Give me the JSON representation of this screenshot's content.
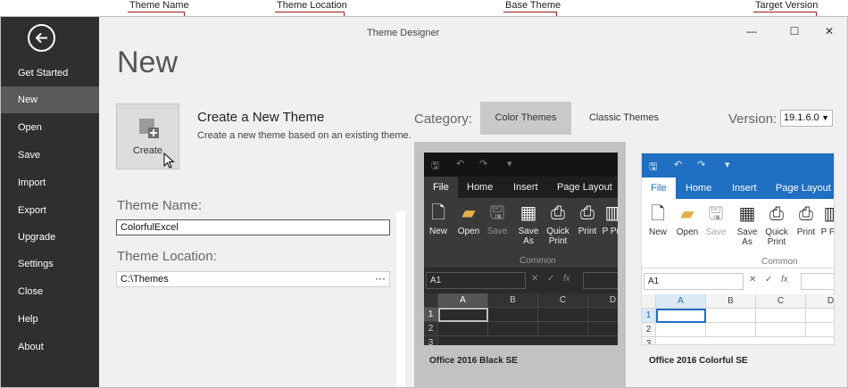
{
  "annotations": [
    {
      "id": "theme-name",
      "label": "Theme Name"
    },
    {
      "id": "theme-location",
      "label": "Theme Location"
    },
    {
      "id": "base-theme",
      "label": "Base Theme"
    },
    {
      "id": "target-version",
      "label": "Target Version"
    }
  ],
  "window": {
    "title": "Theme Designer",
    "minimize_glyph": "—",
    "maximize_glyph": "☐",
    "close_glyph": "✕"
  },
  "sidebar": {
    "back_icon": "back-arrow-icon",
    "items": [
      {
        "label": "Get Started"
      },
      {
        "label": "New",
        "active": true
      },
      {
        "label": "Open"
      },
      {
        "label": "Save"
      },
      {
        "label": "Import"
      },
      {
        "label": "Export"
      },
      {
        "label": "Upgrade"
      },
      {
        "label": "Settings"
      },
      {
        "label": "Close"
      },
      {
        "label": "Help"
      },
      {
        "label": "About"
      }
    ]
  },
  "main": {
    "page_title": "New",
    "create": {
      "tile_label": "Create",
      "heading": "Create a New Theme",
      "description": "Create a new theme based on an existing theme."
    },
    "theme_name": {
      "label": "Theme Name:",
      "value": "ColorfulExcel"
    },
    "theme_location": {
      "label": "Theme Location:",
      "value": "C:\\Themes",
      "browse": "···"
    }
  },
  "themes": {
    "category_label": "Category:",
    "tabs": [
      {
        "label": "Color Themes",
        "selected": true
      },
      {
        "label": "Classic Themes",
        "selected": false
      }
    ],
    "version_label": "Version:",
    "version_value": "19.1.6.0",
    "cards": [
      {
        "name": "Office 2016 Black SE",
        "selected": true
      },
      {
        "name": "Office 2016 Colorful SE",
        "selected": false
      }
    ]
  },
  "preview": {
    "qat": {
      "save": "🖫",
      "undo": "↶",
      "redo": "↷",
      "more": "▾"
    },
    "tabs": {
      "file": "File",
      "home": "Home",
      "insert": "Insert",
      "layout": "Page Layout"
    },
    "ribbon": {
      "new": "New",
      "open": "Open",
      "save": "Save",
      "save_as": "Save As",
      "quick_print": "Quick Print",
      "print": "Print",
      "print_preview": "P Pre",
      "group": "Common"
    },
    "formula": {
      "cell_ref": "A1",
      "cancel": "✕",
      "enter": "✓",
      "fx": "fx"
    },
    "grid": {
      "columns": [
        "A",
        "B",
        "C",
        "D"
      ],
      "rows": [
        "1",
        "2",
        "3"
      ]
    }
  },
  "colors": {
    "accent_annotation": "#9b1b1b",
    "sidebar_bg": "#2f2f2f",
    "colorful_blue": "#1f6fc2"
  }
}
